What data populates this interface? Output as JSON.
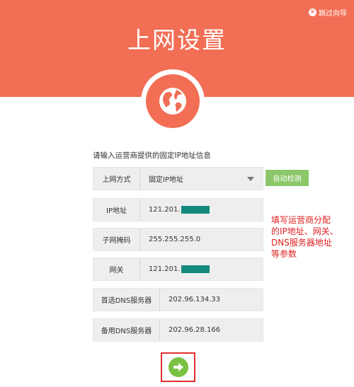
{
  "header": {
    "skip_label": "跳过向导",
    "title": "上网设置",
    "colors": {
      "accent": "#f26e55"
    },
    "badge_icon": "globe-icon"
  },
  "form": {
    "title": "请输入运营商提供的固定IP地址信息",
    "connection_type": {
      "label": "上网方式",
      "value": "固定IP地址"
    },
    "auto_detect_label": "自动检测",
    "ip": {
      "label": "IP地址",
      "value": "121.201."
    },
    "subnet": {
      "label": "子网掩码",
      "value": "255.255.255.0"
    },
    "gateway": {
      "label": "网关",
      "value": "121.201."
    },
    "dns1": {
      "label": "首选DNS服务器",
      "value": "202.96.134.33"
    },
    "dns2": {
      "label": "备用DNS服务器",
      "value": "202.96.28.166"
    }
  },
  "annotation": {
    "lines": [
      "填写运营商分配",
      "的IP地址、网关、",
      "DNS服务器地址",
      "等参数"
    ]
  },
  "next_button": {
    "icon": "arrow-right-icon",
    "color": "#7ac142",
    "highlight": "#e03030"
  }
}
